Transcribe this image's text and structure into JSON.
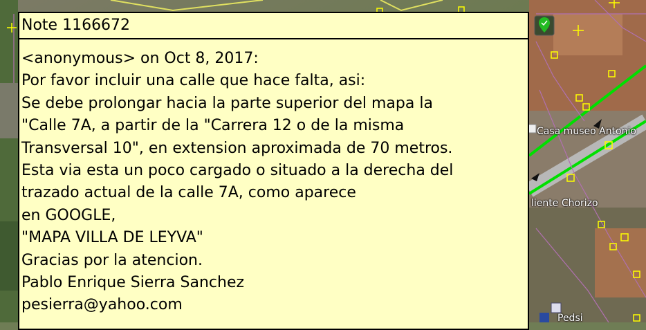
{
  "note": {
    "title": "Note 1166672",
    "lines": [
      "<anonymous> on Oct 8, 2017:",
      "Por favor incluir una calle que hace falta, asi:",
      "Se debe prolongar hacia la parte superior del mapa la",
      "\"Calle 7A, a partir de la \"Carrera 12 o de la misma",
      "Transversal 10\", en extension aproximada de 70 metros.",
      "Esta via esta un poco cargado o situado a la derecha del",
      "trazado actual de la calle 7A, como aparece",
      "en GOOGLE,",
      "\"MAPA VILLA DE LEYVA\"",
      "Gracias por la atencion.",
      "Pablo Enrique Sierra Sanchez",
      "pesierra@yahoo.com"
    ]
  },
  "map": {
    "labels": {
      "museum": "Casa museo Antonio",
      "chorizo": "liente Chorizo",
      "bottom": "Pedsi"
    },
    "colors": {
      "road_green": "#00e000",
      "node_yellow": "#ffff00",
      "boundary_purple": "#b070b0",
      "note_background": "#ffffc4"
    }
  }
}
